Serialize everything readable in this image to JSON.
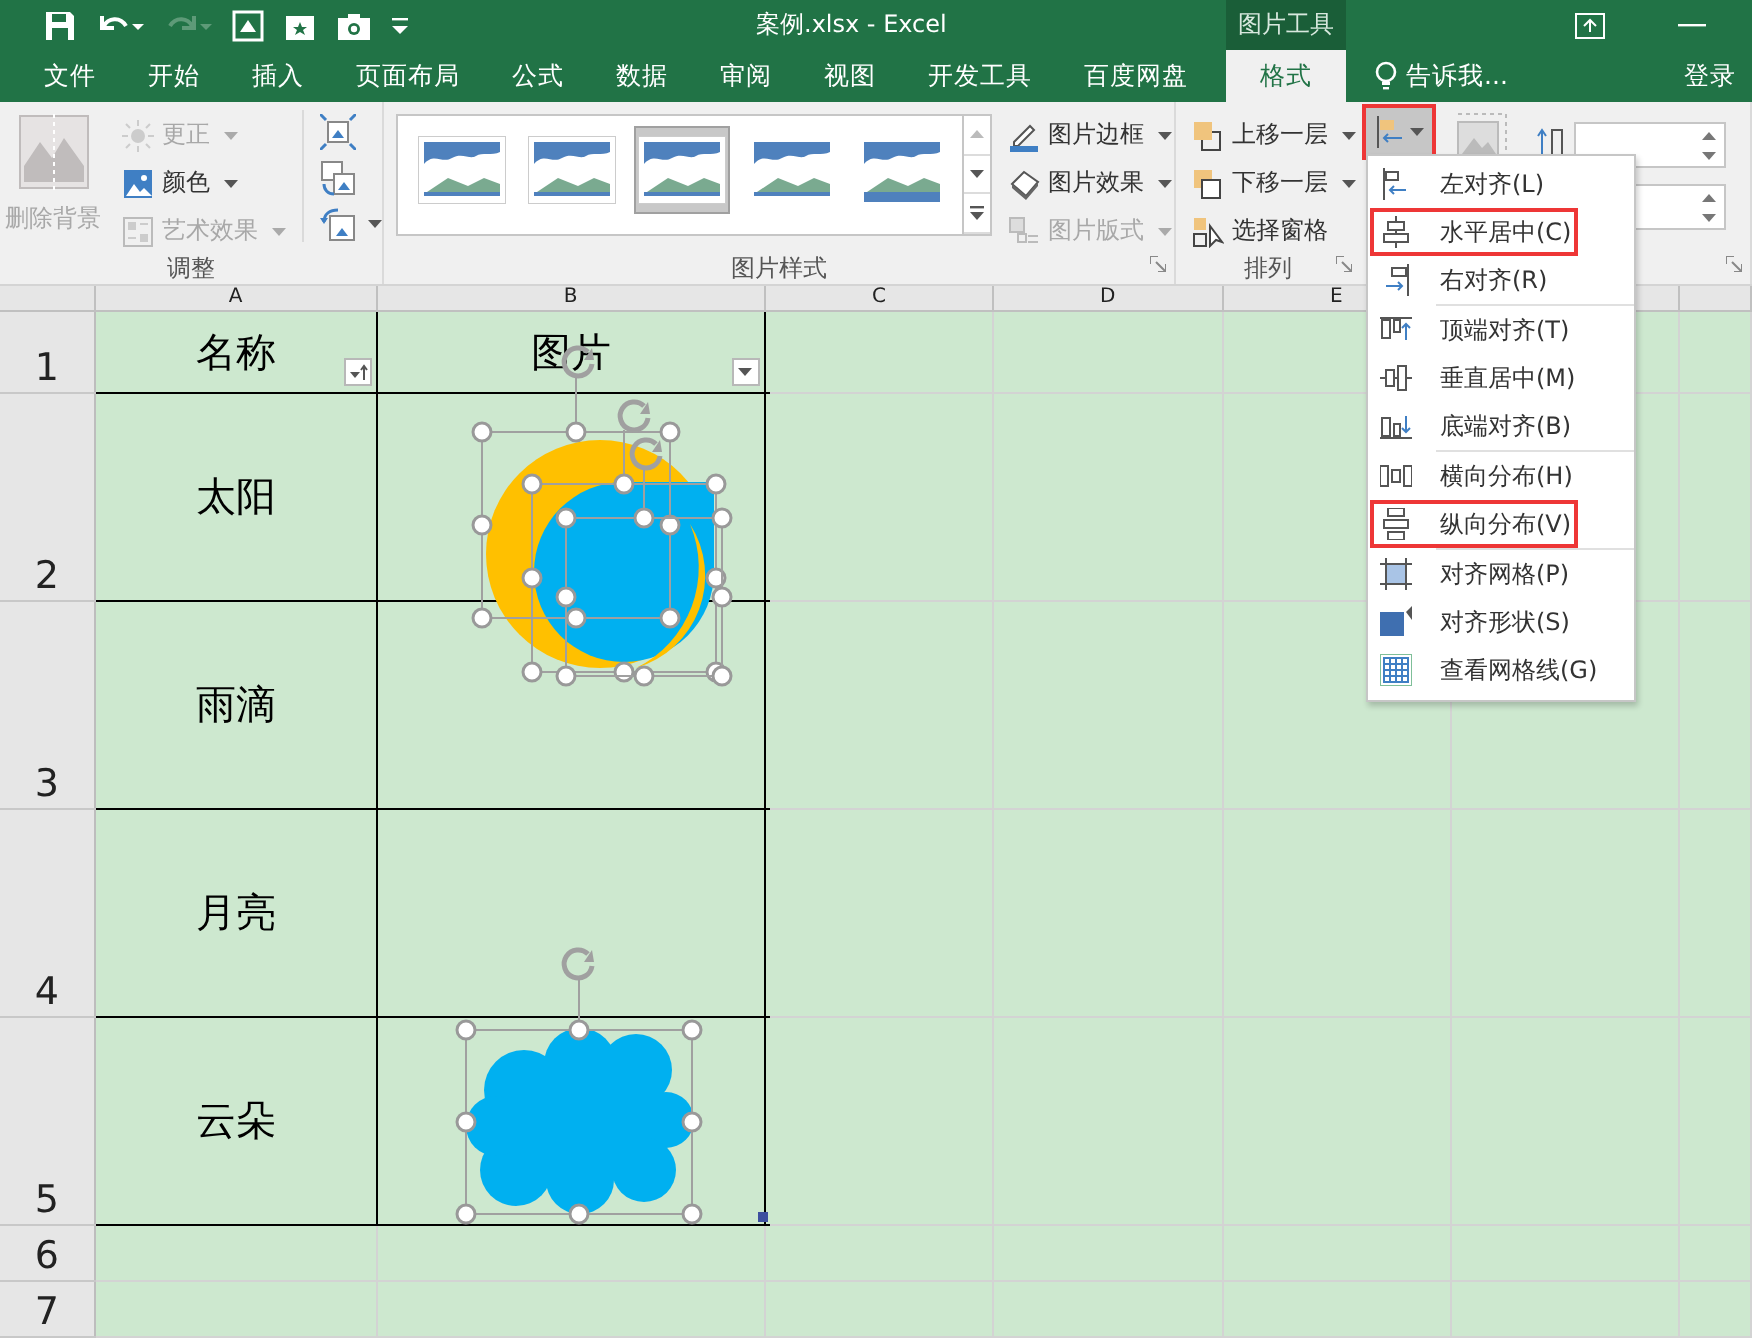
{
  "window": {
    "title": "案例.xlsx - Excel",
    "context_label": "图片工具"
  },
  "tabs": [
    {
      "label": "文件",
      "selected": false
    },
    {
      "label": "开始",
      "selected": false
    },
    {
      "label": "插入",
      "selected": false
    },
    {
      "label": "页面布局",
      "selected": false
    },
    {
      "label": "公式",
      "selected": false
    },
    {
      "label": "数据",
      "selected": false
    },
    {
      "label": "审阅",
      "selected": false
    },
    {
      "label": "视图",
      "selected": false
    },
    {
      "label": "开发工具",
      "selected": false
    },
    {
      "label": "百度网盘",
      "selected": false
    },
    {
      "label": "格式",
      "selected": true
    }
  ],
  "tell_me": "告诉我...",
  "sign_in": "登录",
  "adjust": {
    "title": "调整",
    "remove_background": {
      "label": "删除背景",
      "disabled": true
    },
    "commands": [
      {
        "label": "更正",
        "disabled": true
      },
      {
        "label": "颜色",
        "disabled": false
      },
      {
        "label": "艺术效果",
        "disabled": true
      }
    ]
  },
  "picture_styles": {
    "title": "图片样式",
    "gallery": [
      {
        "selected": false
      },
      {
        "selected": false
      },
      {
        "selected": true
      },
      {
        "selected": false
      },
      {
        "selected": false
      }
    ],
    "commands": [
      {
        "label": "图片边框",
        "disabled": false
      },
      {
        "label": "图片效果",
        "disabled": false
      },
      {
        "label": "图片版式",
        "disabled": true
      }
    ]
  },
  "arrange": {
    "title": "排列",
    "commands": [
      {
        "label": "上移一层",
        "has_menu": true
      },
      {
        "label": "下移一层",
        "has_menu": true
      },
      {
        "label": "选择窗格",
        "has_menu": false
      }
    ],
    "align_button": {
      "highlighted": true
    }
  },
  "align_menu": [
    {
      "label": "左对齐(L)",
      "highlighted": false,
      "separator_before": false
    },
    {
      "label": "水平居中(C)",
      "highlighted": true,
      "separator_before": false
    },
    {
      "label": "右对齐(R)",
      "highlighted": false,
      "separator_before": false
    },
    {
      "label": "顶端对齐(T)",
      "highlighted": false,
      "separator_before": true
    },
    {
      "label": "垂直居中(M)",
      "highlighted": false,
      "separator_before": false
    },
    {
      "label": "底端对齐(B)",
      "highlighted": false,
      "separator_before": false
    },
    {
      "label": "横向分布(H)",
      "highlighted": false,
      "separator_before": true
    },
    {
      "label": "纵向分布(V)",
      "highlighted": true,
      "separator_before": false
    },
    {
      "label": "对齐网格(P)",
      "highlighted": false,
      "separator_before": true
    },
    {
      "label": "对齐形状(S)",
      "highlighted": false,
      "separator_before": false
    },
    {
      "label": "查看网格线(G)",
      "highlighted": false,
      "separator_before": false
    }
  ],
  "sheet": {
    "columns": [
      "A",
      "B",
      "C",
      "D",
      "E"
    ],
    "rows": [
      {
        "number": "1",
        "kind": "header",
        "cells": [
          "名称",
          "图片"
        ]
      },
      {
        "number": "2",
        "kind": "data",
        "cells": [
          "太阳"
        ]
      },
      {
        "number": "3",
        "kind": "data",
        "cells": [
          "雨滴"
        ]
      },
      {
        "number": "4",
        "kind": "data",
        "cells": [
          "月亮"
        ]
      },
      {
        "number": "5",
        "kind": "data",
        "cells": [
          "云朵"
        ]
      },
      {
        "number": "6",
        "kind": "blank"
      },
      {
        "number": "7",
        "kind": "blank"
      }
    ]
  }
}
